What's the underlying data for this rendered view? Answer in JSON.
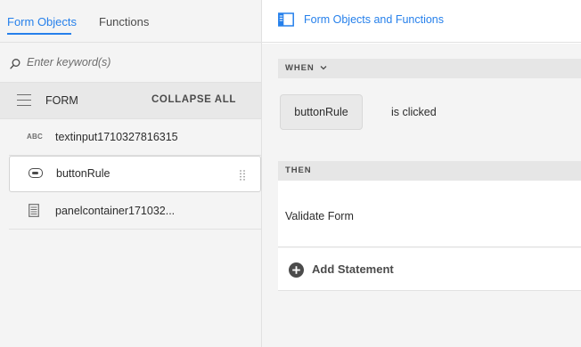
{
  "left_panel": {
    "tabs": [
      {
        "label": "Form Objects",
        "active": true
      },
      {
        "label": "Functions",
        "active": false
      }
    ],
    "search": {
      "placeholder": "Enter keyword(s)",
      "value": ""
    },
    "form_header": {
      "label": "FORM",
      "collapse_all": "COLLAPSE ALL"
    },
    "tree_items": [
      {
        "icon": "text-input-icon",
        "icon_text": "ABC",
        "label": "textinput1710327816315",
        "selected": false
      },
      {
        "icon": "button-icon",
        "label": "buttonRule",
        "selected": true
      },
      {
        "icon": "panel-container-icon",
        "label": "panelcontainer171032..."
      }
    ]
  },
  "right_panel": {
    "header": {
      "icon": "form-objects-functions-icon",
      "label": "Form Objects and Functions"
    },
    "when": {
      "title": "WHEN",
      "component": "buttonRule",
      "event": "is clicked"
    },
    "then": {
      "title": "THEN",
      "action": "Validate Form"
    },
    "add_statement": "Add Statement"
  },
  "colors": {
    "accent": "#2680eb",
    "panel_bg": "#f4f4f4",
    "section_bar": "#e6e6e6"
  }
}
